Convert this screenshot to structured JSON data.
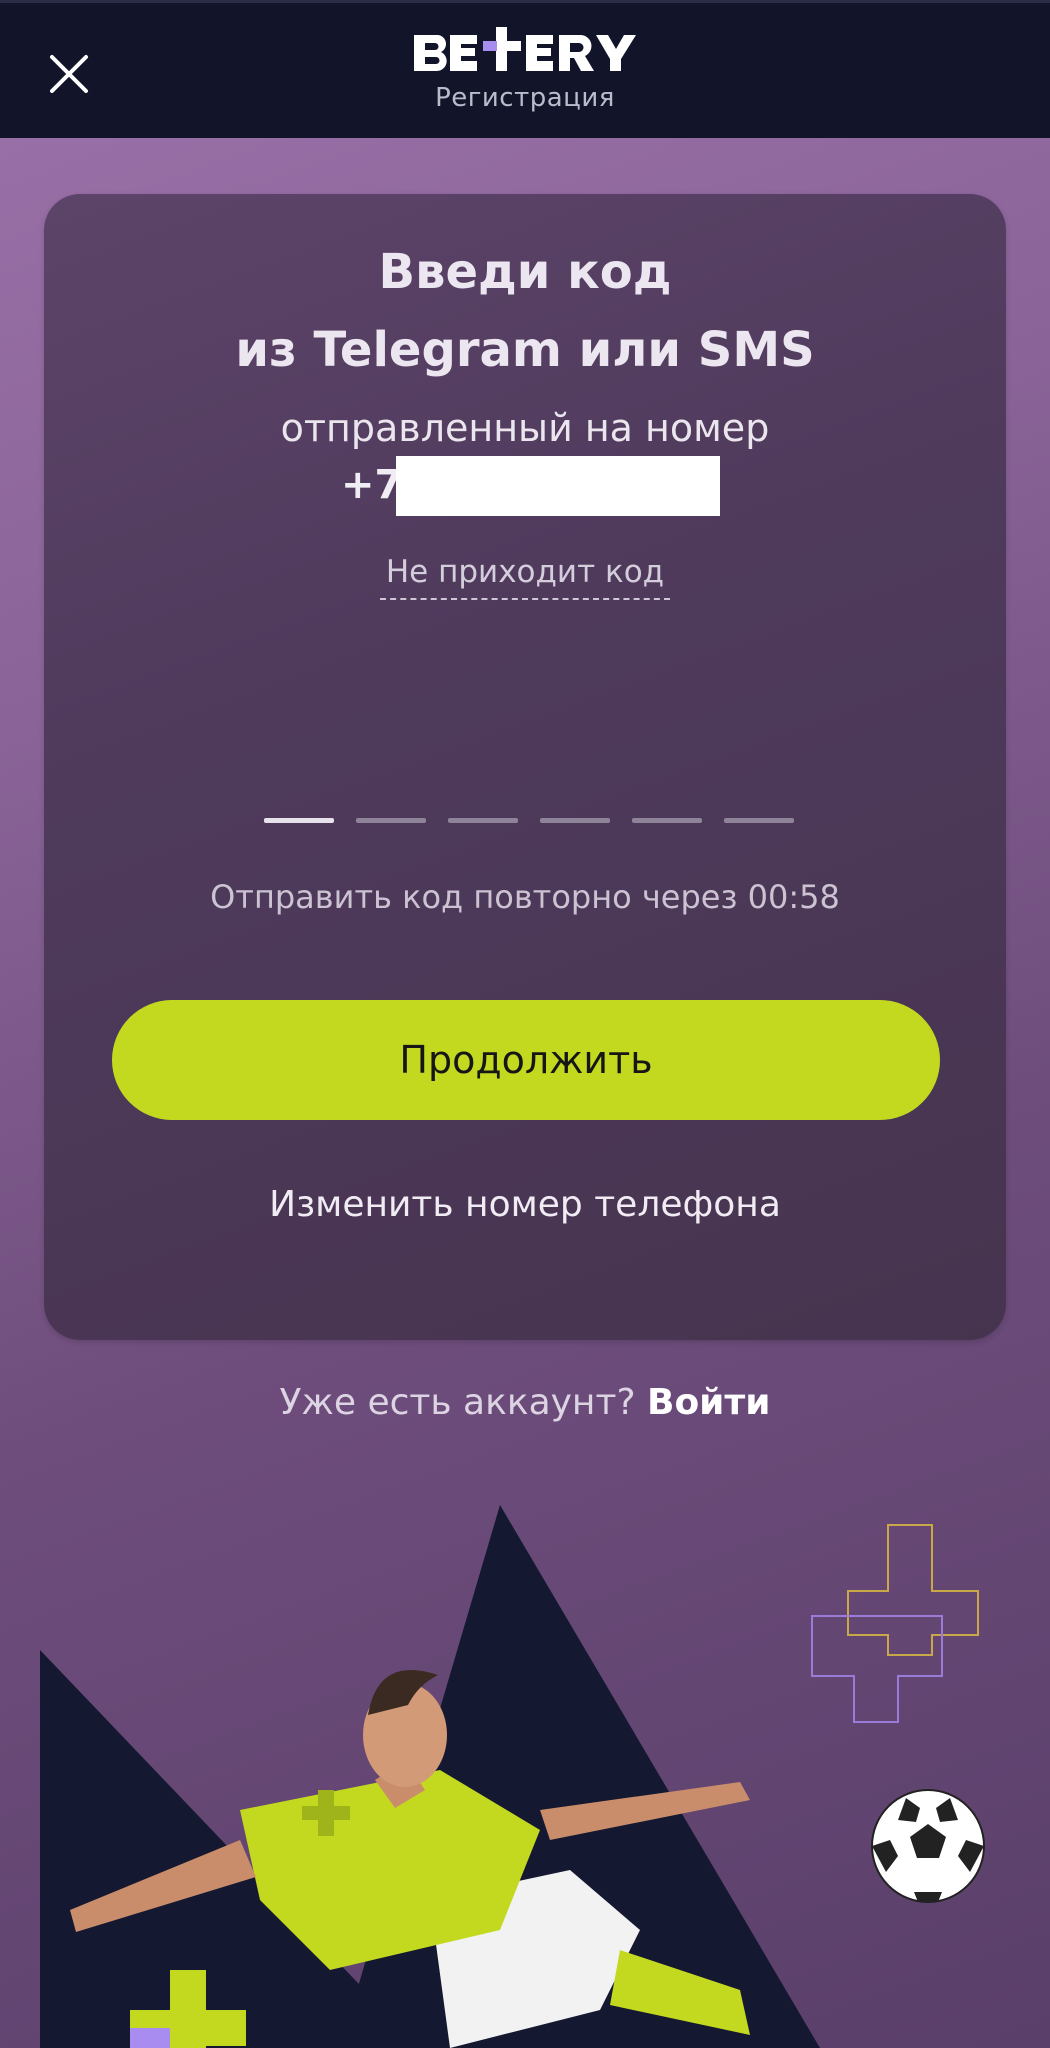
{
  "header": {
    "logo_text": "BETERY",
    "subtitle": "Регистрация"
  },
  "card": {
    "title_line1": "Введи код",
    "title_line2": "из Telegram или SMS",
    "sent_label": "отправленный на номер",
    "phone_prefix": "+7",
    "no_code_link": "Не приходит код",
    "code_length": 6,
    "resend_text": "Отправить код повторно через 00:58",
    "continue_label": "Продолжить",
    "change_phone_label": "Изменить номер телефона"
  },
  "footer": {
    "account_question": "Уже есть аккаунт?",
    "login_label": "Войти"
  },
  "colors": {
    "header_bg": "#121529",
    "accent_green": "#c3d91f",
    "logo_accent": "#a88cf0",
    "background_purple": "#8a6498"
  },
  "icons": {
    "close": "close-icon",
    "ball": "soccer-ball-icon"
  }
}
